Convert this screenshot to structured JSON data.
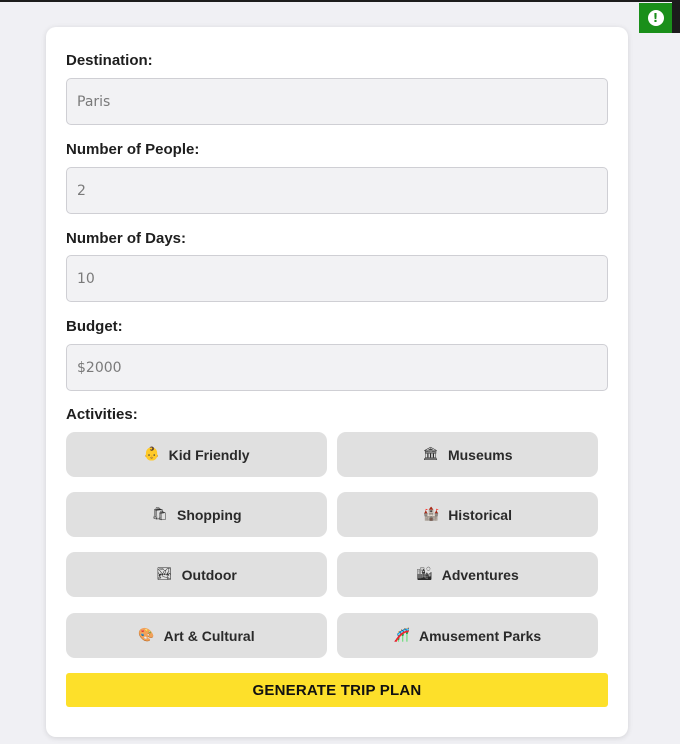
{
  "alert": {
    "icon": "alert-icon",
    "glyph": "!"
  },
  "form": {
    "destination": {
      "label": "Destination:",
      "value": "Paris"
    },
    "people": {
      "label": "Number of People:",
      "value": "2"
    },
    "days": {
      "label": "Number of Days:",
      "value": "10"
    },
    "budget": {
      "label": "Budget:",
      "value": "$2000"
    }
  },
  "activities": {
    "label": "Activities:",
    "items": [
      {
        "label": "Kid Friendly",
        "icon": "baby-icon",
        "glyph": "👶"
      },
      {
        "label": "Museums",
        "icon": "museum-icon",
        "glyph": "🏛"
      },
      {
        "label": "Shopping",
        "icon": "shopping-bags-icon",
        "glyph": "🛍"
      },
      {
        "label": "Historical",
        "icon": "castle-icon",
        "glyph": "🏰"
      },
      {
        "label": "Outdoor",
        "icon": "landscape-icon",
        "glyph": "🏞"
      },
      {
        "label": "Adventures",
        "icon": "cityscape-icon",
        "glyph": "🏙"
      },
      {
        "label": "Art & Cultural",
        "icon": "palette-icon",
        "glyph": "🎨"
      },
      {
        "label": "Amusement Parks",
        "icon": "roller-coaster-icon",
        "glyph": "🎢"
      }
    ]
  },
  "generate_label": "GENERATE TRIP PLAN",
  "colors": {
    "accent": "#fde02a",
    "alert": "#1a8f1a",
    "button_bg": "#e0e0e0"
  }
}
